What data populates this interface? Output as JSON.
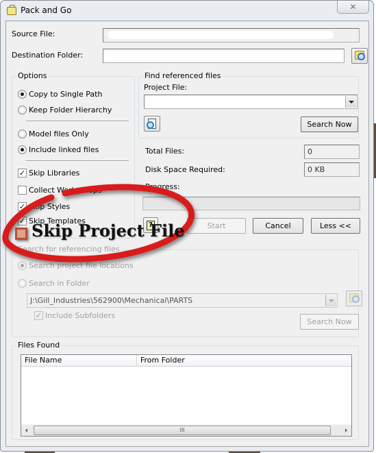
{
  "window": {
    "title": "Pack and Go",
    "close_glyph": "✕"
  },
  "paths": {
    "source_label": "Source File:",
    "source_value": "",
    "destination_label": "Destination Folder:",
    "destination_value": ""
  },
  "options": {
    "title": "Options",
    "path_mode": [
      {
        "label": "Copy to Single Path",
        "selected": true
      },
      {
        "label": "Keep Folder Hierarchy",
        "selected": false
      }
    ],
    "file_mode": [
      {
        "label": "Model files Only",
        "selected": false
      },
      {
        "label": "Include linked files",
        "selected": true
      }
    ],
    "checkboxes": [
      {
        "label": "Skip Libraries",
        "checked": true
      },
      {
        "label": "Collect Workgroups",
        "checked": false
      },
      {
        "label": "Skip Styles",
        "checked": true
      },
      {
        "label": "Skip Templates",
        "checked": true
      }
    ]
  },
  "find_referenced": {
    "title": "Find referenced files",
    "project_file_label": "Project File:",
    "project_file_value": "",
    "search_now": "Search Now"
  },
  "stats": {
    "total_files_label": "Total Files:",
    "total_files_value": "0",
    "disk_space_label": "Disk Space Required:",
    "disk_space_value": "0 KB",
    "progress_label": "Progress:",
    "progress_value": 0
  },
  "actions": {
    "help_glyph": "?",
    "start": "Start",
    "cancel": "Cancel",
    "less": "Less <<"
  },
  "annotation": {
    "text": "Skip Project File",
    "color": "#d81e1e"
  },
  "referencing": {
    "title": "Search for referencing files",
    "options": [
      {
        "label": "Search project file locations",
        "selected": true
      },
      {
        "label": "Search in Folder",
        "selected": false
      }
    ],
    "folder_value": "J:\\Gill_Industries\\562900\\Mechanical\\PARTS",
    "include_subfolders": "Include Subfolders",
    "include_subfolders_checked": true,
    "search_now": "Search Now"
  },
  "files_found": {
    "title": "Files Found",
    "columns": [
      "File Name",
      "From Folder"
    ],
    "rows": [],
    "scroll_glyph": "III"
  }
}
